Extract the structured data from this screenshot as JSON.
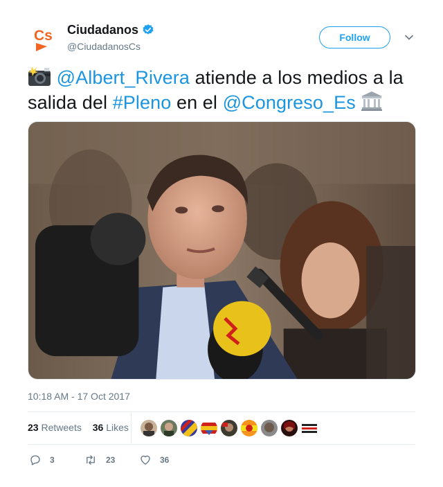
{
  "account": {
    "display_name": "Ciudadanos",
    "handle": "@CiudadanosCs",
    "logo_text": "Cs",
    "brand_color": "#f26522",
    "verified": true
  },
  "follow_label": "Follow",
  "tweet": {
    "emoji_camera": "camera-flash-emoji",
    "mention_1": "@Albert_Rivera",
    "text_1": " atiende a los medios a la salida del ",
    "hashtag": "#Pleno",
    "text_2": " en el ",
    "mention_2": "@Congreso_Es",
    "emoji_building": "classical-building-emoji"
  },
  "timestamp": "10:18 AM - 17 Oct 2017",
  "stats": {
    "retweets_count": "23",
    "retweets_label": "Retweets",
    "likes_count": "36",
    "likes_label": "Likes"
  },
  "actions": {
    "replies": "3",
    "retweets": "23",
    "likes": "36"
  },
  "colors": {
    "link": "#1b95e0",
    "muted": "#657786",
    "twitter_blue": "#1da1f2"
  }
}
